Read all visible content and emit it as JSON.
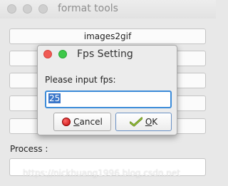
{
  "window": {
    "title": "format tools"
  },
  "main": {
    "buttons": [
      {
        "label": "images2gif"
      },
      {
        "label": ""
      },
      {
        "label": ""
      },
      {
        "label": ""
      },
      {
        "label": ""
      }
    ],
    "process_label": "Process :"
  },
  "dialog": {
    "title": "Fps Setting",
    "prompt": "Please input fps:",
    "input_value": "25",
    "cancel": {
      "label_first": "C",
      "label_rest": "ancel"
    },
    "ok": {
      "label_first": "O",
      "label_rest": "K"
    }
  },
  "watermark": "https://nickhuang1996.blog.csdn.net",
  "icons": {
    "cancel": "cancel-icon",
    "ok": "ok-check-icon"
  },
  "colors": {
    "close": "#f05a54",
    "maximize": "#3ec84a",
    "input_focus": "#3b8bd9",
    "selection": "#3a76c9"
  }
}
